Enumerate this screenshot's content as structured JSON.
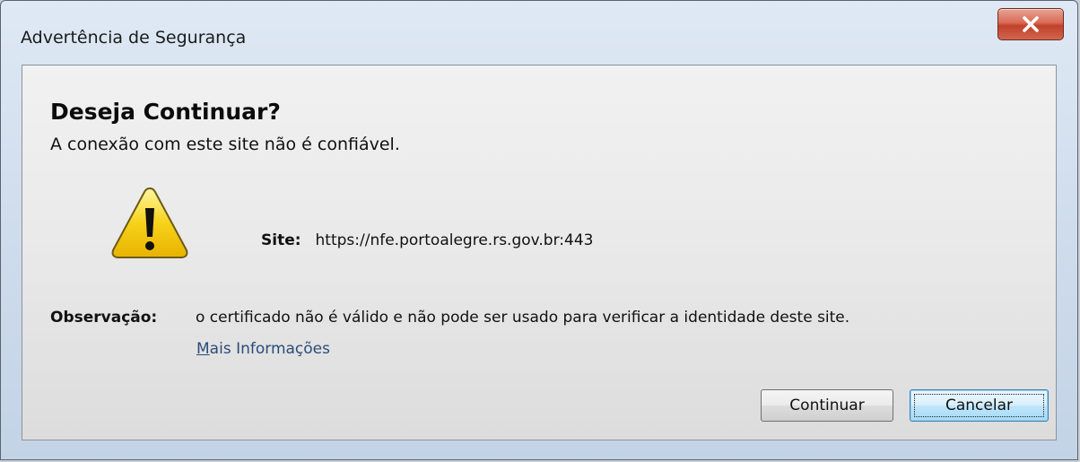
{
  "window": {
    "title": "Advertência de Segurança",
    "close_icon": "close-icon"
  },
  "dialog": {
    "heading": "Deseja Continuar?",
    "subheading": "A conexão com este site não é confiável.",
    "icon": "warning-icon",
    "site_label": "Site:",
    "site_value": "https://nfe.portoalegre.rs.gov.br:443",
    "observation_label": "Observação:",
    "observation_text": "o certificado não é válido e não pode ser usado para verificar a identidade deste site.",
    "more_info_link_first": "M",
    "more_info_link_rest": "ais Informações"
  },
  "buttons": {
    "continue_label": "Continuar",
    "cancel_label": "Cancelar"
  },
  "colors": {
    "close_button": "#c1412a",
    "warning_fill": "#f7d21a",
    "link": "#2a4c7a",
    "default_button_border": "#3c7fb1"
  }
}
